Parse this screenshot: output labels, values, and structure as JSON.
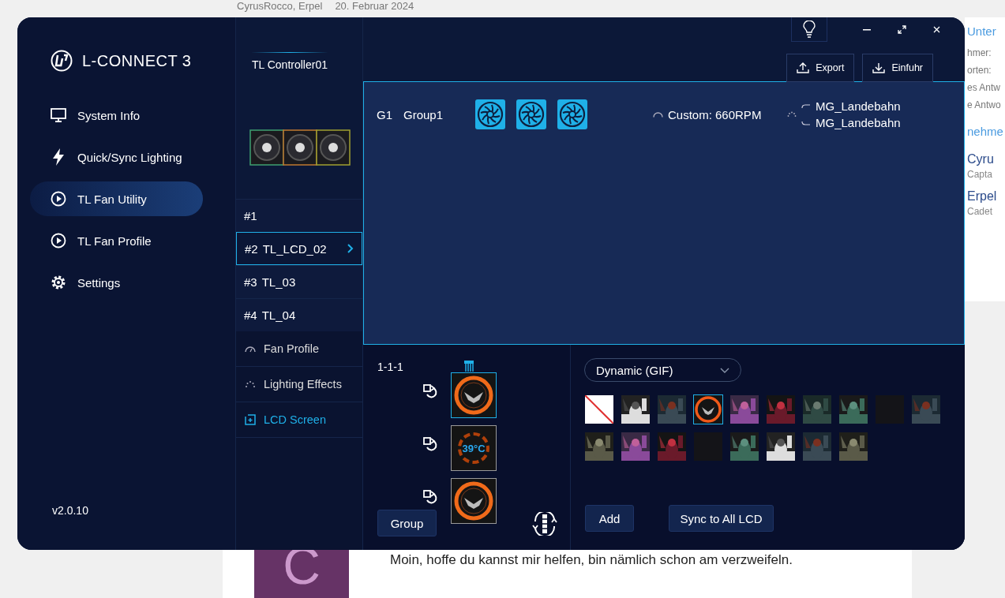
{
  "page": {
    "meta": [
      "CyrusRocco, Erpel",
      "20. Februar 2024"
    ],
    "side_fragments": [
      {
        "text": "Unter",
        "kind": "heading"
      },
      {
        "text": "hmer:",
        "kind": "label"
      },
      {
        "text": "orten:",
        "kind": "label"
      },
      {
        "text": "es Antw",
        "kind": "label"
      },
      {
        "text": "e Antwo",
        "kind": "label"
      },
      {
        "text": "nehme",
        "kind": "heading"
      },
      {
        "text": "Cyru",
        "kind": "name"
      },
      {
        "text": "Capta",
        "kind": "rank"
      },
      {
        "text": "Erpel",
        "kind": "name"
      },
      {
        "text": "Cadet",
        "kind": "rank"
      }
    ],
    "avatar_letter": "C",
    "post_text": "Moin, hoffe du kannst mir helfen, bin nämlich schon am verzweifeln."
  },
  "app": {
    "logo": "L-CONNECT 3",
    "nav": [
      {
        "label": "System Info",
        "kind": "monitor",
        "selected": false
      },
      {
        "label": "Quick/Sync Lighting",
        "kind": "bolt",
        "selected": false
      },
      {
        "label": "TL Fan Utility",
        "kind": "play",
        "selected": true
      },
      {
        "label": "TL Fan Profile",
        "kind": "play",
        "selected": false
      },
      {
        "label": "Settings",
        "kind": "gear",
        "selected": false
      }
    ],
    "version": "v2.0.10",
    "controller": "TL Controller01",
    "fans": [
      {
        "number": "#1",
        "selected": false
      },
      {
        "number": "#2",
        "name": "TL_LCD_02",
        "selected": true
      },
      {
        "number": "#3",
        "name": "TL_03",
        "selected": false
      },
      {
        "number": "#4",
        "name": "TL_04",
        "selected": false
      }
    ],
    "sections": [
      {
        "label": "Fan Profile",
        "kind": "gauge",
        "selected": false
      },
      {
        "label": "Lighting Effects",
        "kind": "sparkle",
        "selected": false
      },
      {
        "label": "LCD Screen",
        "kind": "screen",
        "selected": true
      }
    ],
    "top_buttons": [
      "Export",
      "Einfuhr"
    ],
    "group": {
      "id": "G1",
      "name": "Group1",
      "fan_icons": [
        {
          "kind": "fan"
        },
        {
          "kind": "fan"
        },
        {
          "kind": "fan"
        }
      ],
      "speed": "Custom: 660RPM",
      "lighting": [
        "MG_Landebahn",
        "MG_Landebahn"
      ]
    },
    "lcd": {
      "port": "1-1-1",
      "previews": [
        {
          "kind": "emblem",
          "selected": true
        },
        {
          "kind": "temperature",
          "reading": "39°C",
          "selected": false
        },
        {
          "kind": "emblem",
          "selected": false
        }
      ],
      "group_button": "Group",
      "mode": "Dynamic (GIF)",
      "thumbnails": [
        {
          "kind": "none",
          "selected": false
        },
        {
          "kind": "picture",
          "selected": false
        },
        {
          "kind": "picture",
          "selected": false
        },
        {
          "kind": "emblem",
          "selected": true
        },
        {
          "kind": "picture",
          "selected": false
        },
        {
          "kind": "picture",
          "selected": false
        },
        {
          "kind": "picture",
          "selected": false
        },
        {
          "kind": "picture",
          "selected": false
        },
        {
          "kind": "blank",
          "selected": false
        },
        {
          "kind": "picture",
          "selected": false
        },
        {
          "kind": "picture",
          "selected": false
        },
        {
          "kind": "picture",
          "selected": false
        },
        {
          "kind": "picture",
          "selected": false
        },
        {
          "kind": "blank",
          "selected": false
        },
        {
          "kind": "picture",
          "selected": false
        },
        {
          "kind": "picture",
          "selected": false
        },
        {
          "kind": "picture",
          "selected": false
        },
        {
          "kind": "picture",
          "selected": false
        }
      ],
      "buttons": [
        "Add",
        "Sync to All LCD"
      ]
    }
  }
}
